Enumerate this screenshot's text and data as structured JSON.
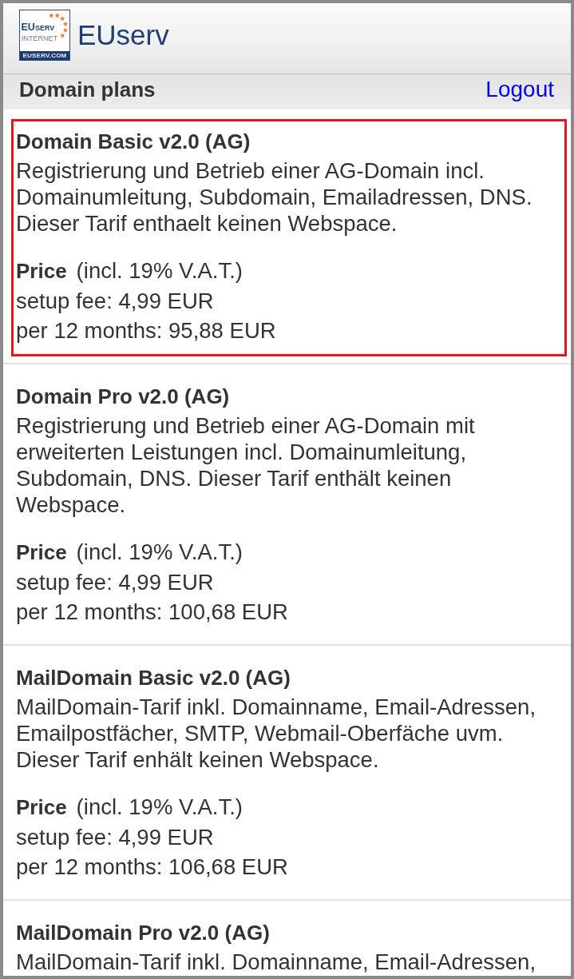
{
  "header": {
    "logo": {
      "wordmark": "EUSERV",
      "tagline": "INTERNET",
      "domain": "EUSERV.COM"
    },
    "title": "EUserv"
  },
  "toolbar": {
    "title": "Domain plans",
    "logout": "Logout"
  },
  "plans": [
    {
      "title": "Domain Basic v2.0 (AG)",
      "description": "Registrierung und Betrieb einer AG-Domain incl.\nDomainumleitung, Subdomain, Emailadressen, DNS.\nDieser Tarif enthaelt keinen Webspace.",
      "selected": true,
      "price": {
        "label": "Price",
        "note": "(incl. 19% V.A.T.)",
        "setup_fee": "setup fee: 4,99 EUR",
        "recurring_fee": "per 12 months: 95,88 EUR"
      }
    },
    {
      "title": "Domain Pro v2.0 (AG)",
      "description": "Registrierung und Betrieb einer AG-Domain mit\nerweiterten Leistungen incl. Domainumleitung,\nSubdomain, DNS. Dieser Tarif enthält keinen\nWebspace.",
      "selected": false,
      "price": {
        "label": "Price",
        "note": "(incl. 19% V.A.T.)",
        "setup_fee": "setup fee: 4,99 EUR",
        "recurring_fee": "per 12 months: 100,68 EUR"
      }
    },
    {
      "title": "MailDomain Basic v2.0 (AG)",
      "description": "MailDomain-Tarif inkl. Domainname, Email-Adressen,\nEmailpostfächer, SMTP, Webmail-Oberfäche uvm.\nDieser Tarif enhält keinen Webspace.",
      "selected": false,
      "price": {
        "label": "Price",
        "note": "(incl. 19% V.A.T.)",
        "setup_fee": "setup fee: 4,99 EUR",
        "recurring_fee": "per 12 months: 106,68 EUR"
      }
    },
    {
      "title": "MailDomain Pro v2.0 (AG)",
      "description": "MailDomain-Tarif inkl. Domainname, Email-Adressen,",
      "selected": false
    }
  ]
}
